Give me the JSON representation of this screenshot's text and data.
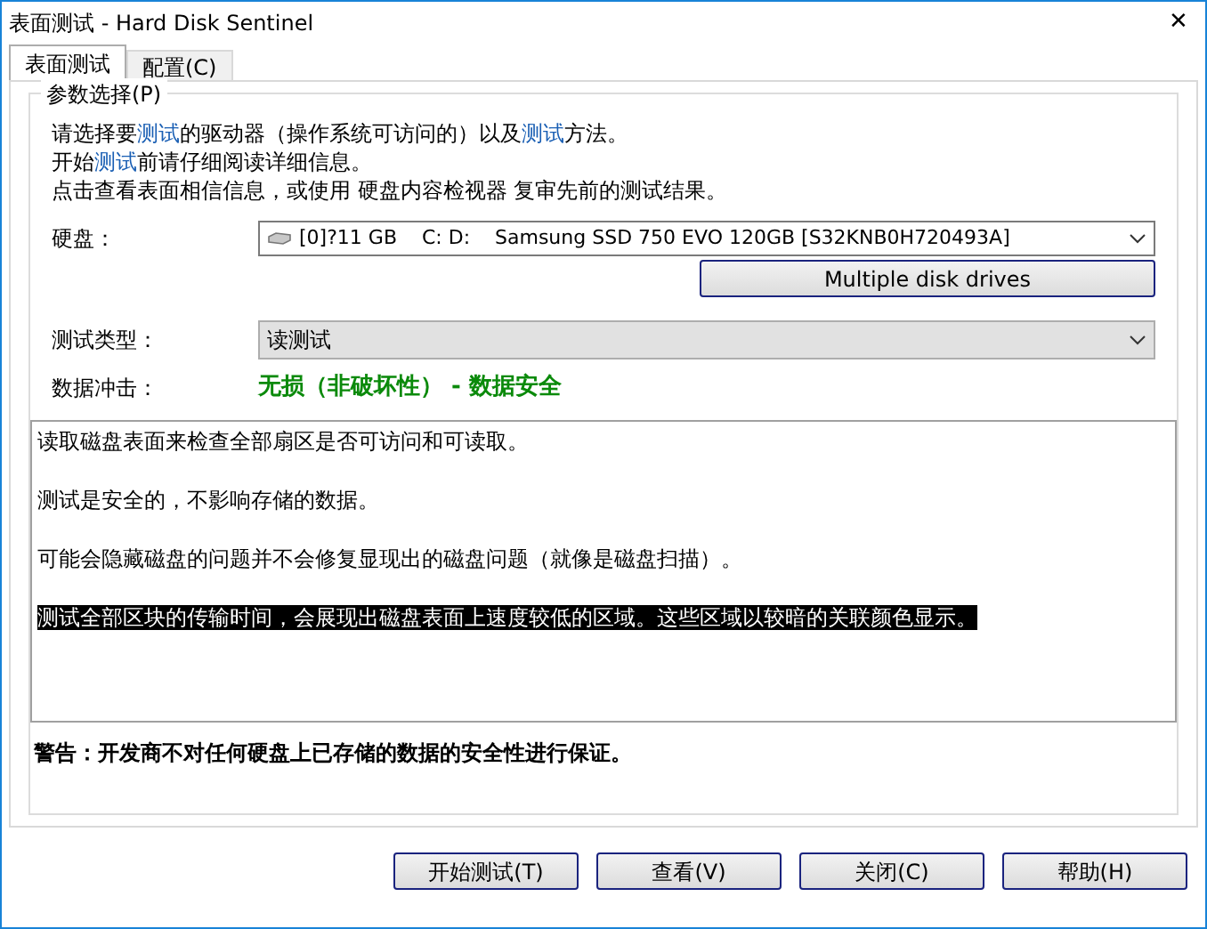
{
  "window": {
    "title": "表面测试 - Hard Disk Sentinel",
    "close": "✕"
  },
  "tabs": [
    {
      "label": "表面测试",
      "selected": true
    },
    {
      "label": "配置(C)",
      "selected": false
    }
  ],
  "group": {
    "title": "参数选择(P)",
    "intro": [
      [
        {
          "text": "请选择要",
          "highlight": false
        },
        {
          "text": "测试",
          "highlight": true
        },
        {
          "text": "的驱动器（操作系统可访问的）以及",
          "highlight": false
        },
        {
          "text": "测试",
          "highlight": true
        },
        {
          "text": "方法。",
          "highlight": false
        }
      ],
      [
        {
          "text": "开始",
          "highlight": false
        },
        {
          "text": "测试",
          "highlight": true
        },
        {
          "text": "前请仔细阅读详细信息。",
          "highlight": false
        }
      ],
      [
        {
          "text": "点击查看表面相信信息，或使用 硬盘内容检视器 复审先前的测试结果。",
          "highlight": false
        }
      ]
    ],
    "disk_label": "硬盘：",
    "disk_value": "[0]?11 GB    C: D:    Samsung SSD 750 EVO 120GB [S32KNB0H720493A]",
    "multi_button": "Multiple disk drives",
    "type_label": "测试类型：",
    "type_value": "读测试",
    "impact_label": "数据冲击：",
    "impact_value": "无损（非破坏性） - 数据安全",
    "description": [
      {
        "text": "读取磁盘表面来检查全部扇区是否可访问和可读取。",
        "selected": false
      },
      {
        "text": "测试是安全的，不影响存储的数据。",
        "selected": false
      },
      {
        "text": "可能会隐藏磁盘的问题并不会修复显现出的磁盘问题（就像是磁盘扫描）。",
        "selected": false
      },
      {
        "text": "测试全部区块的传输时间，会展现出磁盘表面上速度较低的区域。这些区域以较暗的关联颜色显示。",
        "selected": true
      }
    ],
    "warning": "警告：开发商不对任何硬盘上已存储的数据的安全性进行保证。"
  },
  "buttons": [
    "开始测试(T)",
    "查看(V)",
    "关闭(C)",
    "帮助(H)"
  ]
}
